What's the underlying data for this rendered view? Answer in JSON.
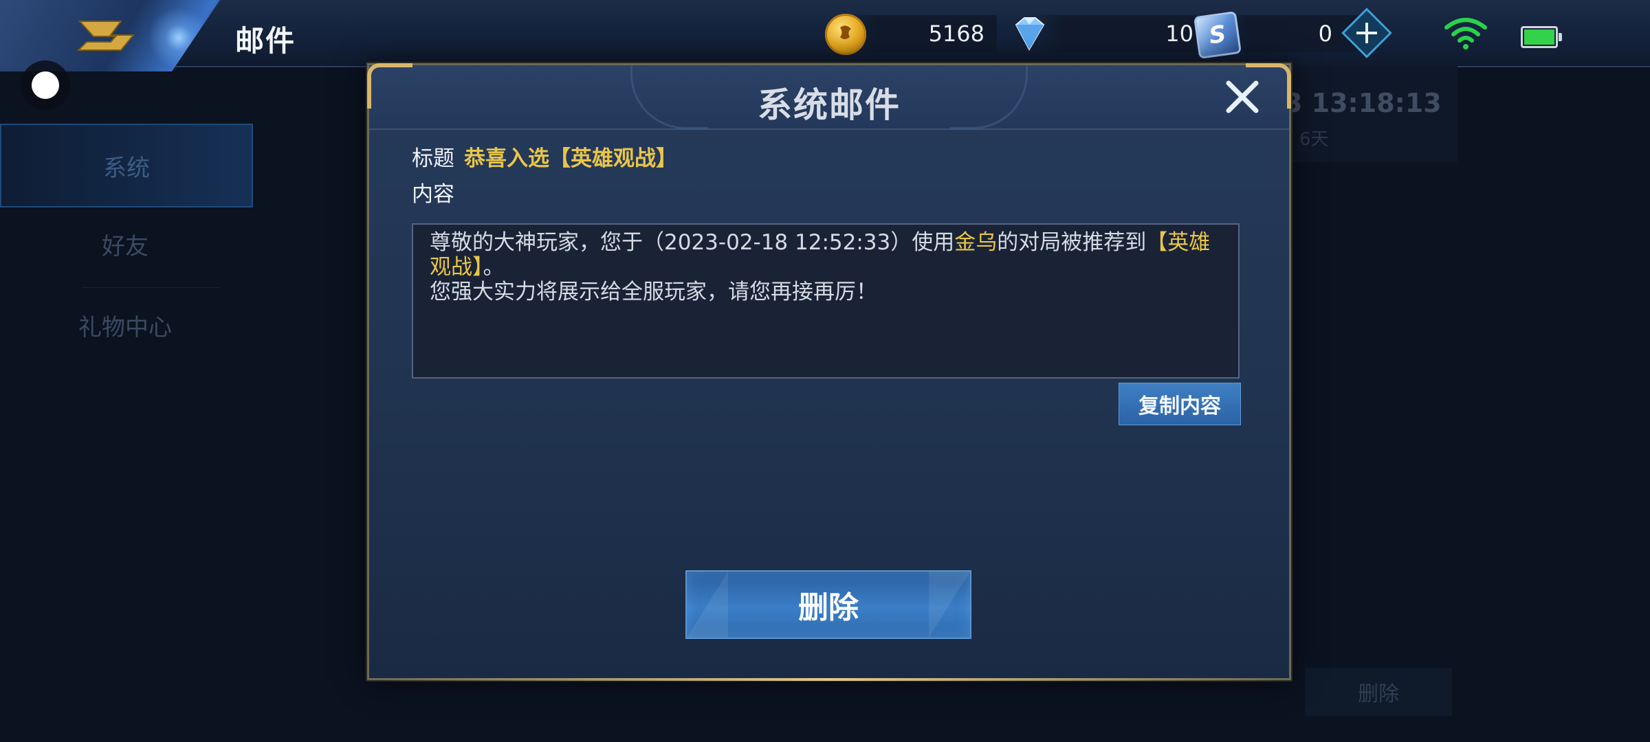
{
  "header": {
    "title": "邮件",
    "currencies": [
      {
        "icon": "gold-coin-icon",
        "value": "5168"
      },
      {
        "icon": "diamond-icon",
        "value": "10"
      },
      {
        "icon": "token-icon",
        "value": "0"
      }
    ]
  },
  "sidebar": {
    "items": [
      {
        "label": "系统",
        "active": true
      },
      {
        "label": "好友",
        "active": false
      },
      {
        "label": "礼物中心",
        "active": false
      }
    ]
  },
  "background": {
    "time": "3 13:18:13",
    "days": "6天",
    "delete_label": "删除"
  },
  "dialog": {
    "title": "系统邮件",
    "subject_label": "标题",
    "subject": "恭喜入选【英雄观战】",
    "content_label": "内容",
    "content": {
      "part1": "尊敬的大神玩家，您于（2023-02-18 12:52:33）使用",
      "hero": "金乌",
      "part2": "的对局被推荐到",
      "tag": "【英雄观战】",
      "part3": "。",
      "line2": "您强大实力将展示给全服玩家，请您再接再厉！"
    },
    "copy_label": "复制内容",
    "delete_label": "删除"
  },
  "colors": {
    "highlight": "#e9c64a",
    "accent": "#3a7ec7",
    "gold_border": "#d9b66a"
  }
}
